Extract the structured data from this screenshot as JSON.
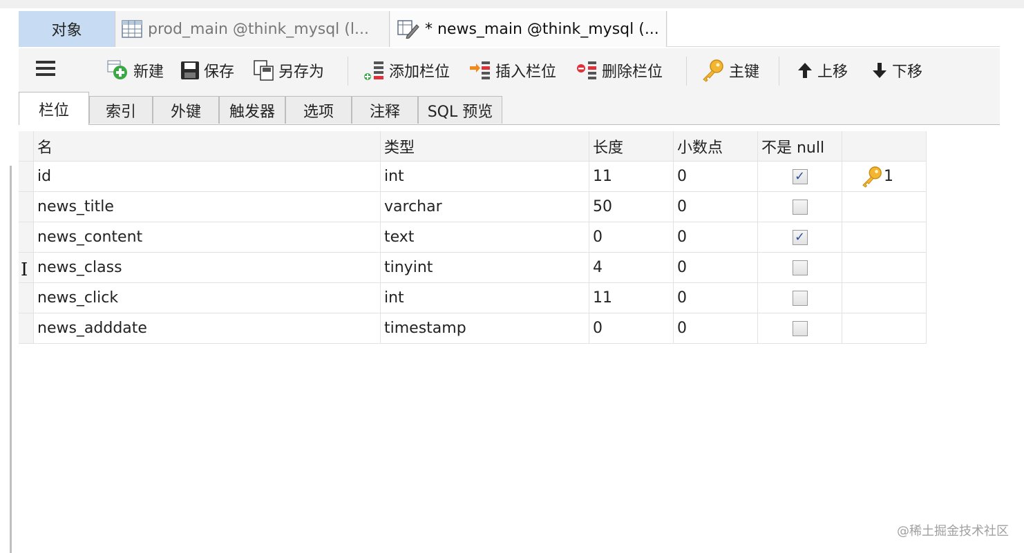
{
  "window_tabs": {
    "objects": "对象",
    "prod": "prod_main @think_mysql (l...",
    "news": "* news_main @think_mysql (..."
  },
  "toolbar": {
    "new": "新建",
    "save": "保存",
    "save_as": "另存为",
    "add_field": "添加栏位",
    "insert_field": "插入栏位",
    "delete_field": "删除栏位",
    "primary_key": "主键",
    "move_up": "上移",
    "move_down": "下移"
  },
  "sub_tabs": [
    "栏位",
    "索引",
    "外键",
    "触发器",
    "选项",
    "注释",
    "SQL 预览"
  ],
  "columns": {
    "name": "名",
    "type": "类型",
    "length": "长度",
    "decimals": "小数点",
    "not_null": "不是 null"
  },
  "rows": [
    {
      "name": "id",
      "type": "int",
      "length": "11",
      "decimals": "0",
      "not_null": true,
      "key": "1"
    },
    {
      "name": "news_title",
      "type": "varchar",
      "length": "50",
      "decimals": "0",
      "not_null": false,
      "key": ""
    },
    {
      "name": "news_content",
      "type": "text",
      "length": "0",
      "decimals": "0",
      "not_null": true,
      "key": ""
    },
    {
      "name": "news_class",
      "type": "tinyint",
      "length": "4",
      "decimals": "0",
      "not_null": false,
      "key": ""
    },
    {
      "name": "news_click",
      "type": "int",
      "length": "11",
      "decimals": "0",
      "not_null": false,
      "key": ""
    },
    {
      "name": "news_adddate",
      "type": "timestamp",
      "length": "0",
      "decimals": "0",
      "not_null": false,
      "key": ""
    }
  ],
  "watermark": "@稀土掘金技术社区",
  "icons": [
    "table-icon",
    "edit-icon",
    "menu-icon",
    "new-icon",
    "save-icon",
    "save-as-icon",
    "add-field-icon",
    "insert-field-icon",
    "delete-field-icon",
    "key-icon",
    "arrow-up-icon",
    "arrow-down-icon",
    "text-cursor-icon"
  ]
}
